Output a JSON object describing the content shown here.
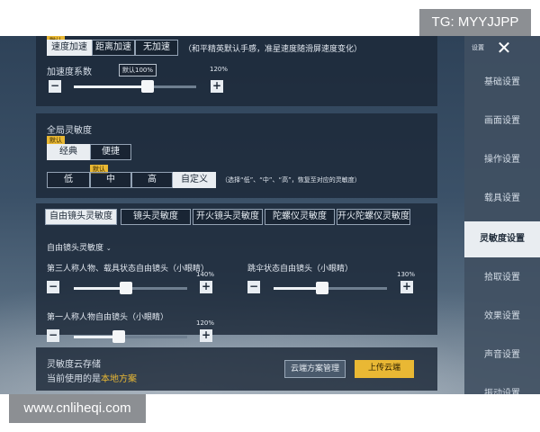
{
  "overlays": {
    "telegram": "TG: MYYJJPP",
    "website": "www.cnliheqi.com"
  },
  "acceleration": {
    "default_tag": "默认",
    "modes": [
      "速度加速",
      "距离加速",
      "无加速"
    ],
    "selected_mode": 0,
    "mode_note": "（和平精英默认手感，准星速度随滑屏速度变化）",
    "coef_label": "加速度系数",
    "coef_tooltip": "默认100%",
    "coef_value": "120%",
    "coef_fraction": 0.6
  },
  "global": {
    "title": "全局灵敏度",
    "default_tag": "默认",
    "styles": [
      "经典",
      "便捷"
    ],
    "selected_style": 0,
    "levels_default_tag": "默认",
    "levels": [
      "低",
      "中",
      "高",
      "自定义"
    ],
    "selected_level": 3,
    "levels_note": "（选择“低”、“中”、“高”，恢复至对应的灵敏度）"
  },
  "tabs": [
    "自由镜头灵敏度",
    "镜头灵敏度",
    "开火镜头灵敏度",
    "陀螺仪灵敏度",
    "开火陀螺仪灵敏度"
  ],
  "selected_tab": 0,
  "free_camera": {
    "title": "自由镜头灵敏度",
    "third_person": {
      "label": "第三人称人物、载具状态自由镜头（小眼睛）",
      "value": "140%",
      "fraction": 0.46
    },
    "parachute": {
      "label": "跳伞状态自由镜头（小眼睛）",
      "value": "130%",
      "fraction": 0.43
    },
    "first_person": {
      "label": "第一人称人物自由镜头（小眼睛）",
      "value": "120%",
      "fraction": 0.4
    }
  },
  "cloud": {
    "title": "灵敏度云存储",
    "current_prefix": "当前使用的是",
    "current_scheme": "本地方案",
    "manage_button": "云端方案管理",
    "upload_button": "上传云端"
  },
  "sidebar": {
    "header_label": "设置",
    "items": [
      "基础设置",
      "画面设置",
      "操作设置",
      "载具设置",
      "灵敏度设置",
      "拾取设置",
      "效果设置",
      "声音设置",
      "振动设置"
    ],
    "selected": 4
  },
  "colors": {
    "accent": "#e9b834",
    "selected_bg": "#e9edf1",
    "link": "#e9b834"
  },
  "icons": {
    "close": "close-icon",
    "minus": "minus-icon",
    "plus": "plus-icon"
  }
}
